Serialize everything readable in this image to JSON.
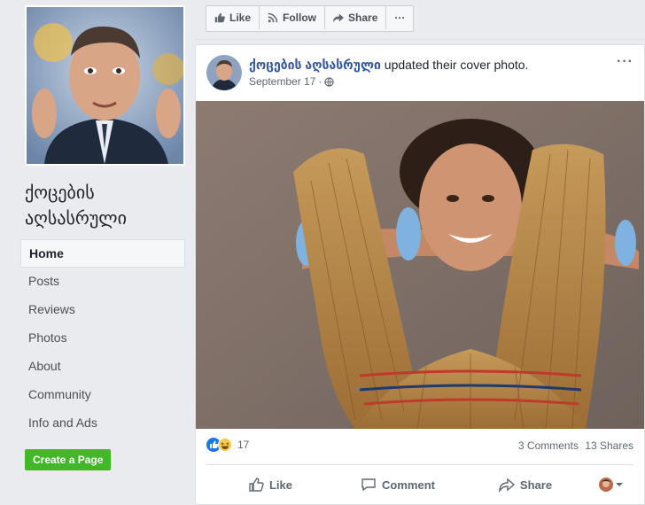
{
  "sidebar": {
    "page_name": "ქოცების აღსასრული",
    "items": [
      {
        "label": "Home",
        "active": true
      },
      {
        "label": "Posts"
      },
      {
        "label": "Reviews"
      },
      {
        "label": "Photos"
      },
      {
        "label": "About"
      },
      {
        "label": "Community"
      },
      {
        "label": "Info and Ads"
      }
    ],
    "create_page_label": "Create a Page"
  },
  "actionbar": {
    "like_label": "Like",
    "follow_label": "Follow",
    "share_label": "Share",
    "more_label": "···"
  },
  "post": {
    "author": "ქოცების აღსასრული",
    "action_text": "updated their cover photo.",
    "date": "September 17",
    "separator": "·",
    "privacy_icon": "globe-icon",
    "more_label": "···",
    "reaction_count": "17",
    "comments": "3 Comments",
    "shares": "13 Shares",
    "reaction_icons": [
      "like-icon",
      "haha-icon"
    ]
  },
  "post_actions": {
    "like_label": "Like",
    "comment_label": "Comment",
    "share_label": "Share"
  },
  "colors": {
    "link": "#365899",
    "create_button": "#42b72a",
    "background": "#e9ebee"
  }
}
